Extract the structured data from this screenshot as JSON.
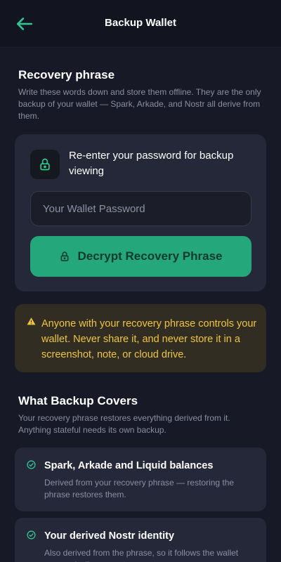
{
  "header": {
    "title": "Backup Wallet",
    "back_icon": "arrow-left-icon"
  },
  "recovery": {
    "title": "Recovery phrase",
    "description": "Write these words down and store them offline. They are the only backup of your wallet — Spark, Arkade, and Nostr all derive from them."
  },
  "password_card": {
    "lock_icon": "lock-icon",
    "heading": "Re-enter your password for backup viewing",
    "input_placeholder": "Your Wallet Password",
    "input_value": "",
    "button_label": "Decrypt Recovery Phrase",
    "button_icon": "lock-icon"
  },
  "warning": {
    "icon": "warning-icon",
    "text": "Anyone with your recovery phrase controls your wallet. Never share it, and never store it in a screenshot, note, or cloud drive."
  },
  "coverage": {
    "title": "What Backup Covers",
    "description": "Your recovery phrase restores everything derived from it. Anything stateful needs its own backup.",
    "items": [
      {
        "icon": "check-circle-icon",
        "title": "Spark, Arkade and Liquid balances",
        "description": "Derived from your recovery phrase — restoring the phrase restores them."
      },
      {
        "icon": "check-circle-icon",
        "title": "Your derived Nostr identity",
        "description": "Also derived from the phrase, so it follows the wallet automatically."
      }
    ]
  },
  "colors": {
    "background": "#171926",
    "card": "#252839",
    "accent": "#23a77b",
    "icon_green": "#2fc792",
    "warning_text": "#f0c53a"
  }
}
